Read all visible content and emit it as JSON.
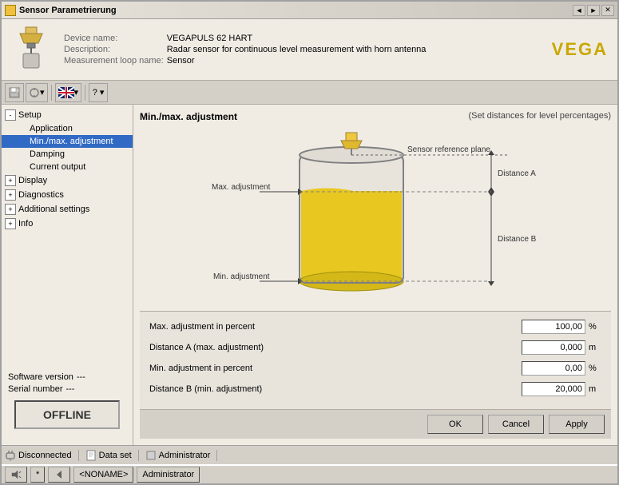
{
  "window": {
    "title": "Sensor Parametrierung",
    "controls": [
      "◄",
      "►",
      "✕"
    ]
  },
  "header": {
    "device_name_label": "Device name:",
    "device_name_value": "VEGAPULS 62 HART",
    "description_label": "Description:",
    "description_value": "Radar sensor for continuous level measurement with horn antenna",
    "measurement_loop_label": "Measurement loop name:",
    "measurement_loop_value": "Sensor",
    "logo": "VEGA"
  },
  "toolbar": {
    "buttons": [
      "💾",
      "🔧",
      "🌍",
      "?"
    ]
  },
  "tree": {
    "items": [
      {
        "label": "Setup",
        "level": 0,
        "expandable": true,
        "expanded": true,
        "selected": false
      },
      {
        "label": "Application",
        "level": 1,
        "expandable": false,
        "expanded": false,
        "selected": false
      },
      {
        "label": "Min./max. adjustment",
        "level": 1,
        "expandable": false,
        "expanded": false,
        "selected": true
      },
      {
        "label": "Damping",
        "level": 1,
        "expandable": false,
        "expanded": false,
        "selected": false
      },
      {
        "label": "Current output",
        "level": 1,
        "expandable": false,
        "expanded": false,
        "selected": false
      },
      {
        "label": "Display",
        "level": 0,
        "expandable": true,
        "expanded": false,
        "selected": false
      },
      {
        "label": "Diagnostics",
        "level": 0,
        "expandable": true,
        "expanded": false,
        "selected": false
      },
      {
        "label": "Additional settings",
        "level": 0,
        "expandable": true,
        "expanded": false,
        "selected": false
      },
      {
        "label": "Info",
        "level": 0,
        "expandable": true,
        "expanded": false,
        "selected": false
      }
    ],
    "software_version_label": "Software version",
    "software_version_value": "---",
    "serial_number_label": "Serial number",
    "serial_number_value": "---",
    "offline_label": "OFFLINE"
  },
  "diagram": {
    "title": "Min./max. adjustment",
    "subtitle": "(Set distances for level percentages)",
    "sensor_reference": "Sensor reference plane",
    "max_adjustment": "Max. adjustment",
    "min_adjustment": "Min. adjustment",
    "distance_a": "Distance A",
    "distance_b": "Distance B"
  },
  "form": {
    "fields": [
      {
        "label": "Max. adjustment in percent",
        "value": "100,00",
        "unit": "%"
      },
      {
        "label": "Distance A (max. adjustment)",
        "value": "0,000",
        "unit": "m"
      },
      {
        "label": "Min. adjustment in percent",
        "value": "0,00",
        "unit": "%"
      },
      {
        "label": "Distance B (min. adjustment)",
        "value": "20,000",
        "unit": "m"
      }
    ]
  },
  "buttons": {
    "ok": "OK",
    "cancel": "Cancel",
    "apply": "Apply"
  },
  "status_bar": {
    "disconnected": "Disconnected",
    "dataset": "Data set",
    "administrator": "Administrator"
  },
  "taskbar": {
    "noname": "<NONAME>",
    "administrator": "Administrator"
  }
}
